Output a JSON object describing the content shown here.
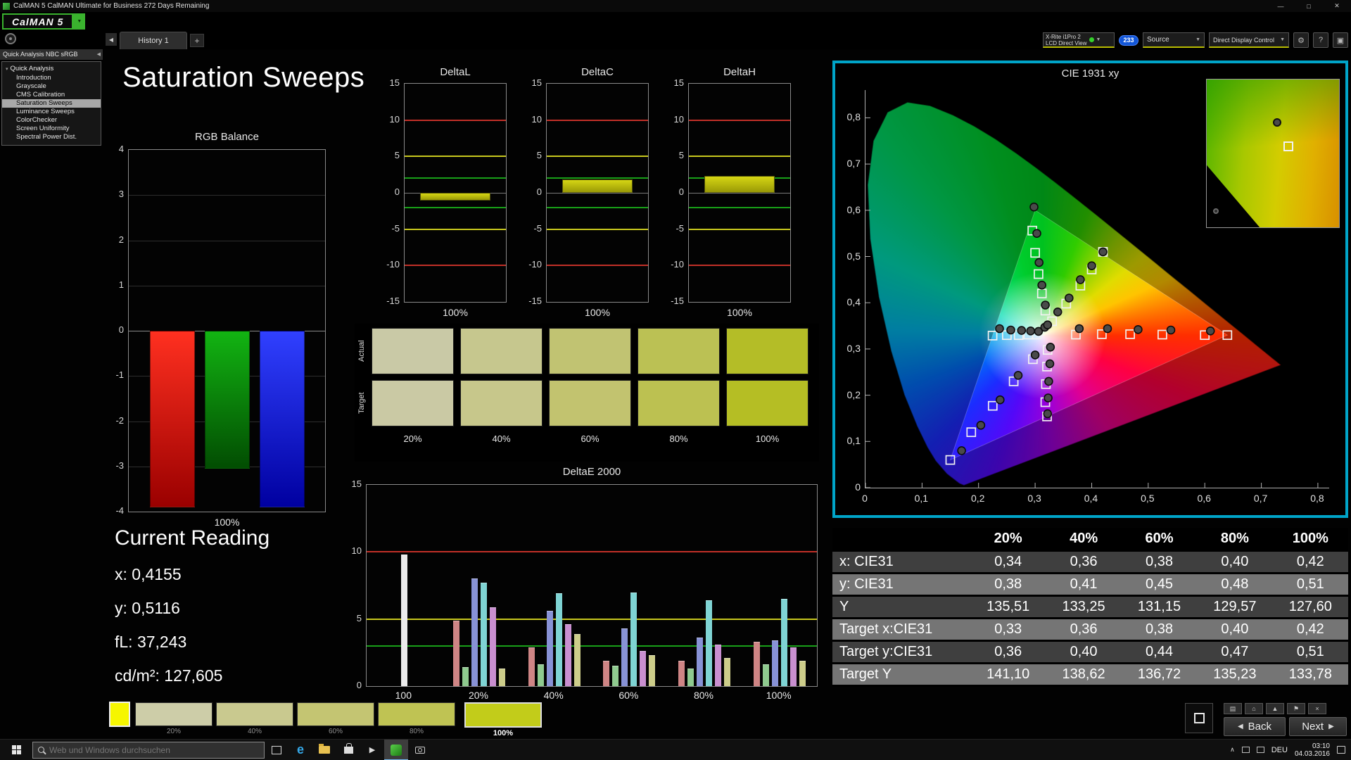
{
  "titlebar": {
    "title": "CalMAN 5 CalMAN Ultimate for Business 272 Days Remaining",
    "minimize": "—",
    "maximize": "□",
    "close": "✕"
  },
  "logo": {
    "text": "CalMAN 5",
    "dropdown": "▼"
  },
  "tabbar": {
    "tab": "History 1",
    "add_tab": "+",
    "collapse": "◀"
  },
  "toolbar": {
    "meter_line1": "X-Rite i1Pro 2",
    "meter_line2": "LCD Direct View",
    "badge": "233",
    "source": "Source",
    "display_control": "Direct Display Control",
    "gear": "⚙",
    "help": "?",
    "panel": "▣",
    "arrow": "▼"
  },
  "sidebar": {
    "header": "Quick Analysis NBC sRGB",
    "root": "Quick Analysis",
    "items": [
      {
        "label": "Introduction",
        "selected": false
      },
      {
        "label": "Grayscale",
        "selected": false
      },
      {
        "label": "CMS Calibration",
        "selected": false
      },
      {
        "label": "Saturation Sweeps",
        "selected": true
      },
      {
        "label": "Luminance Sweeps",
        "selected": false
      },
      {
        "label": "ColorChecker",
        "selected": false
      },
      {
        "label": "Screen Uniformity",
        "selected": false
      },
      {
        "label": "Spectral Power Dist.",
        "selected": false
      }
    ]
  },
  "page": {
    "title": "Saturation Sweeps"
  },
  "current_reading": {
    "title": "Current Reading",
    "lines": [
      "x: 0,4155",
      "y: 0,5116",
      "fL: 37,243",
      "cd/m²: 127,605"
    ]
  },
  "swatches": {
    "row_labels": [
      "Actual",
      "Target"
    ],
    "percent_labels": [
      "20%",
      "40%",
      "60%",
      "80%",
      "100%"
    ],
    "actual_colors": [
      "#c9c9a6",
      "#c6c78e",
      "#c1c372",
      "#bbc154",
      "#b4bd27"
    ],
    "target_colors": [
      "#cac9a4",
      "#c7c78b",
      "#c2c36f",
      "#bcc151",
      "#b5be24"
    ]
  },
  "chart_data": [
    {
      "id": "rgb_balance",
      "type": "bar",
      "title": "RGB Balance",
      "categories": [
        "Red",
        "Green",
        "Blue"
      ],
      "values": [
        -3.9,
        -3.05,
        -3.9
      ],
      "bar_colors": [
        [
          "#ff3020",
          "#9a0000"
        ],
        [
          "#12b412",
          "#024d02"
        ],
        [
          "#3040ff",
          "#0000a0"
        ]
      ],
      "ylim": [
        -4,
        4
      ],
      "tick_step": 1,
      "tick_labels": [
        "4",
        "3",
        "2",
        "1",
        "0",
        "-1",
        "-2",
        "-3",
        "-4"
      ],
      "xlabel": "100%"
    },
    {
      "id": "deltaL",
      "type": "bar",
      "title": "DeltaL",
      "values": [
        -1.1
      ],
      "ylim": [
        -15,
        15
      ],
      "tick_step": 5,
      "tick_labels": [
        "15",
        "10",
        "5",
        "0",
        "-5",
        "-10",
        "-15"
      ],
      "xlabel": "100%",
      "ref_lines": [
        {
          "y": 10,
          "color": "#c23028"
        },
        {
          "y": -10,
          "color": "#c23028"
        },
        {
          "y": 5,
          "color": "#c8c81e"
        },
        {
          "y": -5,
          "color": "#c8c81e"
        },
        {
          "y": 2,
          "color": "#18a018"
        },
        {
          "y": -2,
          "color": "#18a018"
        }
      ]
    },
    {
      "id": "deltaC",
      "type": "bar",
      "title": "DeltaC",
      "values": [
        1.8
      ],
      "ylim": [
        -15,
        15
      ],
      "tick_step": 5,
      "tick_labels": [
        "15",
        "10",
        "5",
        "0",
        "-5",
        "-10",
        "-15"
      ],
      "xlabel": "100%",
      "ref_lines": [
        {
          "y": 10,
          "color": "#c23028"
        },
        {
          "y": -10,
          "color": "#c23028"
        },
        {
          "y": 5,
          "color": "#c8c81e"
        },
        {
          "y": -5,
          "color": "#c8c81e"
        },
        {
          "y": 2,
          "color": "#18a018"
        },
        {
          "y": -2,
          "color": "#18a018"
        }
      ]
    },
    {
      "id": "deltaH",
      "type": "bar",
      "title": "DeltaH",
      "values": [
        2.3
      ],
      "ylim": [
        -15,
        15
      ],
      "tick_step": 5,
      "tick_labels": [
        "15",
        "10",
        "5",
        "0",
        "-5",
        "-10",
        "-15"
      ],
      "xlabel": "100%",
      "ref_lines": [
        {
          "y": 10,
          "color": "#c23028"
        },
        {
          "y": -10,
          "color": "#c23028"
        },
        {
          "y": 5,
          "color": "#c8c81e"
        },
        {
          "y": -5,
          "color": "#c8c81e"
        },
        {
          "y": 2,
          "color": "#18a018"
        },
        {
          "y": -2,
          "color": "#18a018"
        }
      ]
    },
    {
      "id": "deltae2000",
      "type": "bar",
      "title": "DeltaE 2000",
      "ylim": [
        0,
        15
      ],
      "tick_labels": [
        "15",
        "10",
        "5",
        "0"
      ],
      "ref_lines": [
        {
          "y": 10,
          "color": "#c23028"
        },
        {
          "y": 5,
          "color": "#c8c81e"
        },
        {
          "y": 3,
          "color": "#18a018"
        }
      ],
      "groups": [
        {
          "label": "100",
          "bars": [
            [
              "#ececec",
              9.8
            ]
          ]
        },
        {
          "label": "20%",
          "bars": [
            [
              "#cf8585",
              4.9
            ],
            [
              "#8fca8f",
              1.4
            ],
            [
              "#8892d6",
              8.0
            ],
            [
              "#7fd4d4",
              7.7
            ],
            [
              "#c98fd0",
              5.9
            ],
            [
              "#cdcd8a",
              1.3
            ]
          ]
        },
        {
          "label": "40%",
          "bars": [
            [
              "#cf8585",
              2.9
            ],
            [
              "#8fca8f",
              1.6
            ],
            [
              "#8892d6",
              5.6
            ],
            [
              "#7fd4d4",
              6.9
            ],
            [
              "#c98fd0",
              4.6
            ],
            [
              "#cdcd8a",
              3.9
            ]
          ]
        },
        {
          "label": "60%",
          "bars": [
            [
              "#cf8585",
              1.9
            ],
            [
              "#8fca8f",
              1.5
            ],
            [
              "#8892d6",
              4.3
            ],
            [
              "#7fd4d4",
              7.0
            ],
            [
              "#c98fd0",
              2.6
            ],
            [
              "#cdcd8a",
              2.3
            ]
          ]
        },
        {
          "label": "80%",
          "bars": [
            [
              "#cf8585",
              1.9
            ],
            [
              "#8fca8f",
              1.3
            ],
            [
              "#8892d6",
              3.6
            ],
            [
              "#7fd4d4",
              6.4
            ],
            [
              "#c98fd0",
              3.1
            ],
            [
              "#cdcd8a",
              2.1
            ]
          ]
        },
        {
          "label": "100%",
          "bars": [
            [
              "#cf8585",
              3.3
            ],
            [
              "#8fca8f",
              1.6
            ],
            [
              "#8892d6",
              3.4
            ],
            [
              "#7fd4d4",
              6.5
            ],
            [
              "#c98fd0",
              2.9
            ],
            [
              "#cdcd8a",
              1.9
            ]
          ]
        }
      ]
    },
    {
      "id": "cie1931",
      "type": "scatter",
      "title": "CIE 1931 xy",
      "xlim": [
        0,
        0.8
      ],
      "ylim": [
        0,
        0.8
      ],
      "tick_labels": [
        "0",
        "0,1",
        "0,2",
        "0,3",
        "0,4",
        "0,5",
        "0,6",
        "0,7",
        "0,8"
      ],
      "white_point": [
        0.3127,
        0.329
      ],
      "srgb_triangle": [
        [
          0.64,
          0.33
        ],
        [
          0.3,
          0.6
        ],
        [
          0.15,
          0.06
        ]
      ],
      "spectral_locus": [
        [
          0.1741,
          0.005
        ],
        [
          0.166,
          0.009
        ],
        [
          0.1566,
          0.0177
        ],
        [
          0.144,
          0.0297
        ],
        [
          0.1241,
          0.0578
        ],
        [
          0.1096,
          0.0868
        ],
        [
          0.0913,
          0.1327
        ],
        [
          0.0687,
          0.2007
        ],
        [
          0.0454,
          0.295
        ],
        [
          0.0235,
          0.4127
        ],
        [
          0.0082,
          0.5384
        ],
        [
          0.0039,
          0.6548
        ],
        [
          0.0139,
          0.7502
        ],
        [
          0.0389,
          0.812
        ],
        [
          0.0743,
          0.8338
        ],
        [
          0.1142,
          0.8262
        ],
        [
          0.1547,
          0.8059
        ],
        [
          0.1929,
          0.7816
        ],
        [
          0.2296,
          0.7543
        ],
        [
          0.2658,
          0.7243
        ],
        [
          0.3016,
          0.6923
        ],
        [
          0.3373,
          0.6589
        ],
        [
          0.3731,
          0.6245
        ],
        [
          0.4087,
          0.5896
        ],
        [
          0.4441,
          0.5547
        ],
        [
          0.4788,
          0.5202
        ],
        [
          0.5125,
          0.4866
        ],
        [
          0.5448,
          0.4544
        ],
        [
          0.5752,
          0.4242
        ],
        [
          0.6029,
          0.3965
        ],
        [
          0.627,
          0.3725
        ],
        [
          0.6482,
          0.3514
        ],
        [
          0.6658,
          0.334
        ],
        [
          0.6915,
          0.3083
        ],
        [
          0.7079,
          0.292
        ],
        [
          0.719,
          0.2809
        ],
        [
          0.726,
          0.274
        ],
        [
          0.7347,
          0.2653
        ]
      ],
      "measured": [
        [
          0.34,
          0.38
        ],
        [
          0.36,
          0.41
        ],
        [
          0.38,
          0.45
        ],
        [
          0.4,
          0.48
        ],
        [
          0.42,
          0.51
        ],
        [
          0.318,
          0.395
        ],
        [
          0.312,
          0.438
        ],
        [
          0.307,
          0.487
        ],
        [
          0.303,
          0.55
        ],
        [
          0.298,
          0.607
        ],
        [
          0.378,
          0.344
        ],
        [
          0.428,
          0.344
        ],
        [
          0.482,
          0.342
        ],
        [
          0.54,
          0.341
        ],
        [
          0.61,
          0.339
        ],
        [
          0.306,
          0.338
        ],
        [
          0.292,
          0.339
        ],
        [
          0.276,
          0.34
        ],
        [
          0.257,
          0.341
        ],
        [
          0.237,
          0.344
        ],
        [
          0.327,
          0.304
        ],
        [
          0.326,
          0.268
        ],
        [
          0.324,
          0.23
        ],
        [
          0.323,
          0.194
        ],
        [
          0.322,
          0.16
        ],
        [
          0.3,
          0.287
        ],
        [
          0.27,
          0.243
        ],
        [
          0.238,
          0.19
        ],
        [
          0.204,
          0.135
        ],
        [
          0.17,
          0.08
        ],
        [
          0.317,
          0.347
        ],
        [
          0.322,
          0.352
        ]
      ],
      "targets": [
        [
          0.33,
          0.36
        ],
        [
          0.355,
          0.398
        ],
        [
          0.38,
          0.437
        ],
        [
          0.4,
          0.472
        ],
        [
          0.42,
          0.51
        ],
        [
          0.318,
          0.383
        ],
        [
          0.312,
          0.42
        ],
        [
          0.306,
          0.462
        ],
        [
          0.3,
          0.508
        ],
        [
          0.295,
          0.556
        ],
        [
          0.372,
          0.331
        ],
        [
          0.418,
          0.332
        ],
        [
          0.468,
          0.332
        ],
        [
          0.525,
          0.331
        ],
        [
          0.6,
          0.33
        ],
        [
          0.64,
          0.33
        ],
        [
          0.303,
          0.331
        ],
        [
          0.288,
          0.331
        ],
        [
          0.271,
          0.33
        ],
        [
          0.25,
          0.33
        ],
        [
          0.2247,
          0.329
        ],
        [
          0.322,
          0.298
        ],
        [
          0.321,
          0.262
        ],
        [
          0.319,
          0.224
        ],
        [
          0.318,
          0.185
        ],
        [
          0.321,
          0.154
        ],
        [
          0.296,
          0.278
        ],
        [
          0.262,
          0.23
        ],
        [
          0.225,
          0.177
        ],
        [
          0.187,
          0.12
        ],
        [
          0.15,
          0.06
        ]
      ]
    }
  ],
  "table": {
    "columns": [
      "",
      "20%",
      "40%",
      "60%",
      "80%",
      "100%"
    ],
    "rows": [
      {
        "label": "x: CIE31",
        "values": [
          "0,34",
          "0,36",
          "0,38",
          "0,40",
          "0,42"
        ]
      },
      {
        "label": "y: CIE31",
        "values": [
          "0,38",
          "0,41",
          "0,45",
          "0,48",
          "0,51"
        ]
      },
      {
        "label": "Y",
        "values": [
          "135,51",
          "133,25",
          "131,15",
          "129,57",
          "127,60"
        ]
      },
      {
        "label": "Target x:CIE31",
        "values": [
          "0,33",
          "0,36",
          "0,38",
          "0,40",
          "0,42"
        ]
      },
      {
        "label": "Target y:CIE31",
        "values": [
          "0,36",
          "0,40",
          "0,44",
          "0,47",
          "0,51"
        ]
      },
      {
        "label": "Target Y",
        "values": [
          "141,10",
          "138,62",
          "136,72",
          "135,23",
          "133,78"
        ]
      }
    ]
  },
  "bottom": {
    "current_color": "#f6f600",
    "patterns": [
      {
        "label": "20%",
        "color": "#cdcda8",
        "selected": false
      },
      {
        "label": "40%",
        "color": "#c9c98f",
        "selected": false
      },
      {
        "label": "60%",
        "color": "#c4c572",
        "selected": false
      },
      {
        "label": "80%",
        "color": "#bfc353",
        "selected": false
      },
      {
        "label": "100%",
        "color": "#c2cc1a",
        "selected": true
      }
    ],
    "nav_small": [
      "▤",
      "⌂",
      "▲",
      "⚑",
      "×"
    ],
    "back": "Back",
    "next": "Next",
    "back_arrow": "◀",
    "next_arrow": "▶"
  },
  "taskbar": {
    "search_placeholder": "Web und Windows durchsuchen",
    "caret": "∧",
    "lang": "DEU",
    "time": "03:10",
    "date": "04.03.2016"
  }
}
